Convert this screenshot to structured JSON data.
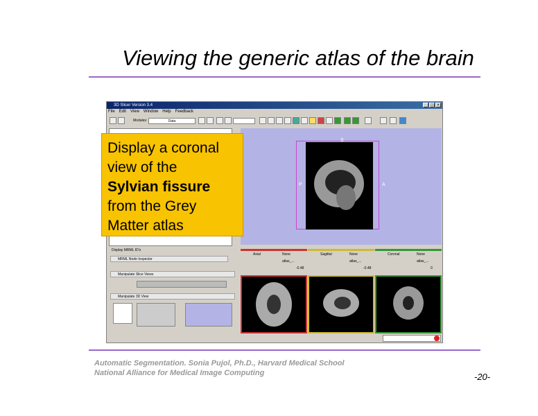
{
  "slide": {
    "title": "Viewing the generic atlas of the brain",
    "footer_line1": "Automatic Segmentation. Sonia Pujol, Ph.D., Harvard Medical School",
    "footer_line2": "National Alliance for Medical Image Computing",
    "page_number": "-20-"
  },
  "callout": {
    "line1": "Display a coronal",
    "line2": "view of the",
    "line3_bold": "Sylvian fissure",
    "line4": "from the Grey",
    "line5": "Matter atlas"
  },
  "app": {
    "window_title": "3D Slicer Version 3.4",
    "menu": [
      "File",
      "Edit",
      "View",
      "Window",
      "Help",
      "Feedback"
    ],
    "modules_label": "Modules:",
    "modules_selected": "Data",
    "left_panel": {
      "display_mrml_ids": "Display MRML ID's",
      "mrml_inspector": "MRML Node Inspector",
      "manipulate_slice_views": "Manipulate Slice Views",
      "manipulate_3d_view": "Manipulate 3D View"
    },
    "view3d": {
      "top": "S",
      "left": "P",
      "right": "A"
    },
    "slices": [
      {
        "name": "Axial",
        "bg": "None",
        "fg": "atlas_...",
        "offset": "-0.48",
        "color": "#cc3333"
      },
      {
        "name": "Sagittal",
        "bg": "None",
        "fg": "atlas_...",
        "offset": "-0.48",
        "color": "#ccbb33"
      },
      {
        "name": "Coronal",
        "bg": "None",
        "fg": "atlas_...",
        "offset": "0",
        "color": "#339933"
      }
    ]
  },
  "colors": {
    "accent_rule": "#9966cc",
    "callout_bg": "#f8c300",
    "view3d_bg": "#b3b3e6"
  }
}
